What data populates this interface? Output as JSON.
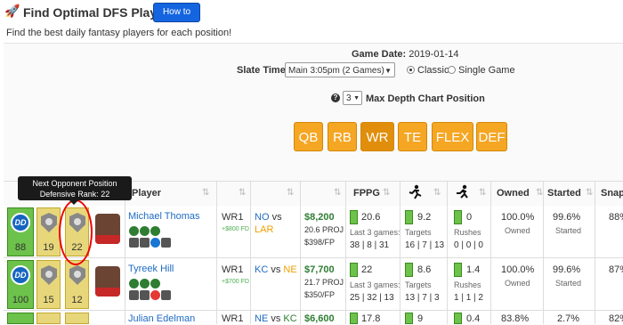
{
  "header": {
    "title": "Find Optimal DFS Players",
    "how_to_use": "How to Use",
    "subtitle": "Find the best daily fantasy players for each position!"
  },
  "filters": {
    "game_date_label": "Game Date:",
    "game_date": "2019-01-14",
    "slate_label": "Slate Time:",
    "slate_value": "Main 3:05pm (2 Games)",
    "classic_label": "Classic",
    "single_game_label": "Single Game",
    "depth_value": "3",
    "depth_label": "Max Depth Chart Position"
  },
  "positions": [
    {
      "label": "QB",
      "selected": false
    },
    {
      "label": "RB",
      "selected": false
    },
    {
      "label": "WR",
      "selected": true
    },
    {
      "label": "TE",
      "selected": false
    },
    {
      "label": "FLEX",
      "selected": false
    },
    {
      "label": "DEF",
      "selected": false
    }
  ],
  "tooltip": {
    "line1": "Next Opponent Position",
    "line2": "Defensive Rank: 22"
  },
  "table": {
    "headers": {
      "player": "Player",
      "fppg": "FPPG",
      "owned": "Owned",
      "started": "Started",
      "snaps": "Snaps"
    },
    "rows": [
      {
        "dd_rank": "88",
        "rank_a": "19",
        "rank_b": "22",
        "name": "Michael Thomas",
        "pos": "WR1",
        "pos_delta": "+$800 FD",
        "team": "NO",
        "vs": "vs",
        "opp": "LAR",
        "salary": "$8,200",
        "proj": "20.6 PROJ",
        "per_fp": "$398/FP",
        "fppg": "20.6",
        "last3_label": "Last 3 games:",
        "last3": "38 | 8 | 31",
        "targets_val": "9.2",
        "targets_label": "Targets",
        "targets_last": "16 | 7 | 13",
        "rushes_val": "0",
        "rushes_label": "Rushes",
        "rushes_last": "0 | 0 | 0",
        "owned": "100.0%",
        "owned_label": "Owned",
        "started": "99.6%",
        "started_label": "Started",
        "snaps": "88%"
      },
      {
        "dd_rank": "100",
        "rank_a": "15",
        "rank_b": "12",
        "name": "Tyreek Hill",
        "pos": "WR1",
        "pos_delta": "+$700 FD",
        "team": "KC",
        "vs": "vs",
        "opp": "NE",
        "salary": "$7,700",
        "proj": "21.7 PROJ",
        "per_fp": "$350/FP",
        "fppg": "22",
        "last3_label": "Last 3 games:",
        "last3": "25 | 32 | 13",
        "targets_val": "8.6",
        "targets_label": "Targets",
        "targets_last": "13 | 7 | 3",
        "rushes_val": "1.4",
        "rushes_label": "Rushes",
        "rushes_last": "1 | 1 | 2",
        "owned": "100.0%",
        "owned_label": "Owned",
        "started": "99.6%",
        "started_label": "Started",
        "snaps": "87%"
      },
      {
        "name": "Julian Edelman",
        "pos": "WR1",
        "team": "NE",
        "vs": "vs",
        "opp": "KC",
        "salary": "$6,600",
        "fppg": "17.8",
        "targets_val": "9",
        "rushes_val": "0.4",
        "owned": "83.8%",
        "started": "2.7%",
        "snaps": "82%"
      }
    ]
  }
}
